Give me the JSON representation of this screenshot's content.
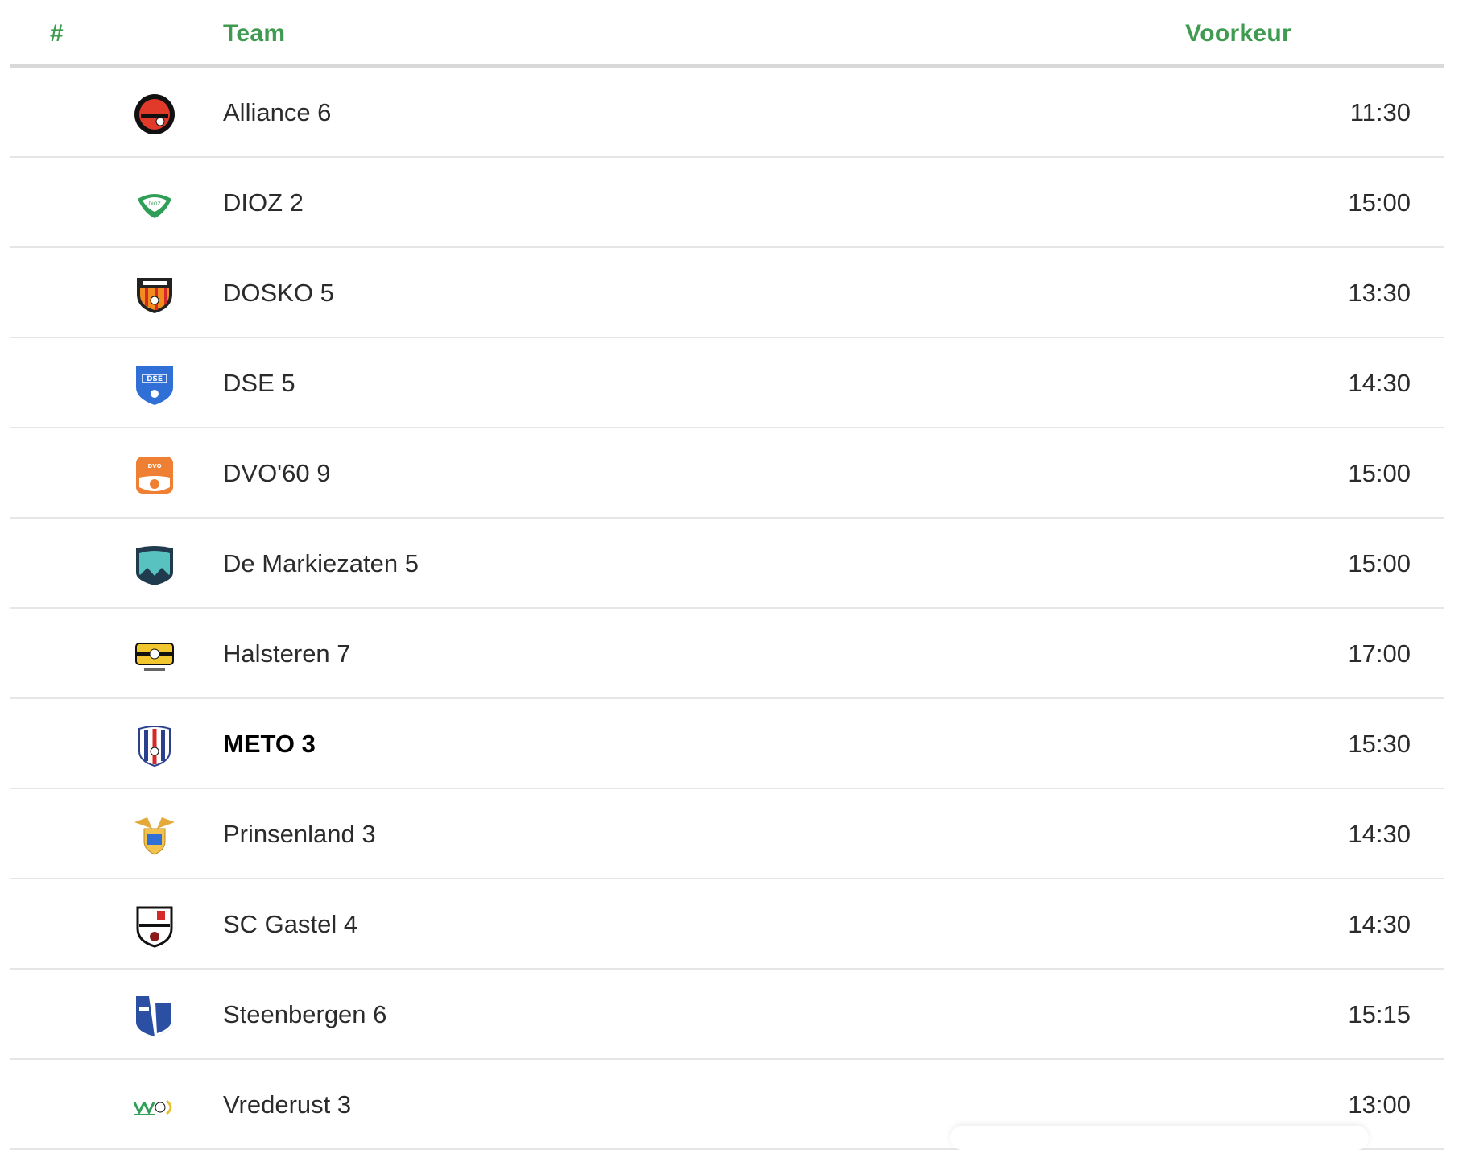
{
  "header": {
    "rank": "#",
    "team": "Team",
    "preference": "Voorkeur"
  },
  "colors": {
    "accent": "#3e9b4f",
    "divider": "#e6e6e6"
  },
  "rows": [
    {
      "team": "Alliance 6",
      "time": "11:30",
      "logo": "alliance-logo-icon",
      "bold": false
    },
    {
      "team": "DIOZ 2",
      "time": "15:00",
      "logo": "dioz-logo-icon",
      "bold": false
    },
    {
      "team": "DOSKO 5",
      "time": "13:30",
      "logo": "dosko-logo-icon",
      "bold": false
    },
    {
      "team": "DSE 5",
      "time": "14:30",
      "logo": "dse-logo-icon",
      "bold": false
    },
    {
      "team": "DVO'60 9",
      "time": "15:00",
      "logo": "dvo60-logo-icon",
      "bold": false
    },
    {
      "team": "De Markiezaten 5",
      "time": "15:00",
      "logo": "markiezaten-logo-icon",
      "bold": false
    },
    {
      "team": "Halsteren 7",
      "time": "17:00",
      "logo": "halsteren-logo-icon",
      "bold": false
    },
    {
      "team": "METO 3",
      "time": "15:30",
      "logo": "meto-logo-icon",
      "bold": true
    },
    {
      "team": "Prinsenland 3",
      "time": "14:30",
      "logo": "prinsenland-logo-icon",
      "bold": false
    },
    {
      "team": "SC Gastel 4",
      "time": "14:30",
      "logo": "sc-gastel-logo-icon",
      "bold": false
    },
    {
      "team": "Steenbergen 6",
      "time": "15:15",
      "logo": "steenbergen-logo-icon",
      "bold": false
    },
    {
      "team": "Vrederust 3",
      "time": "13:00",
      "logo": "vrederust-logo-icon",
      "bold": false
    }
  ]
}
